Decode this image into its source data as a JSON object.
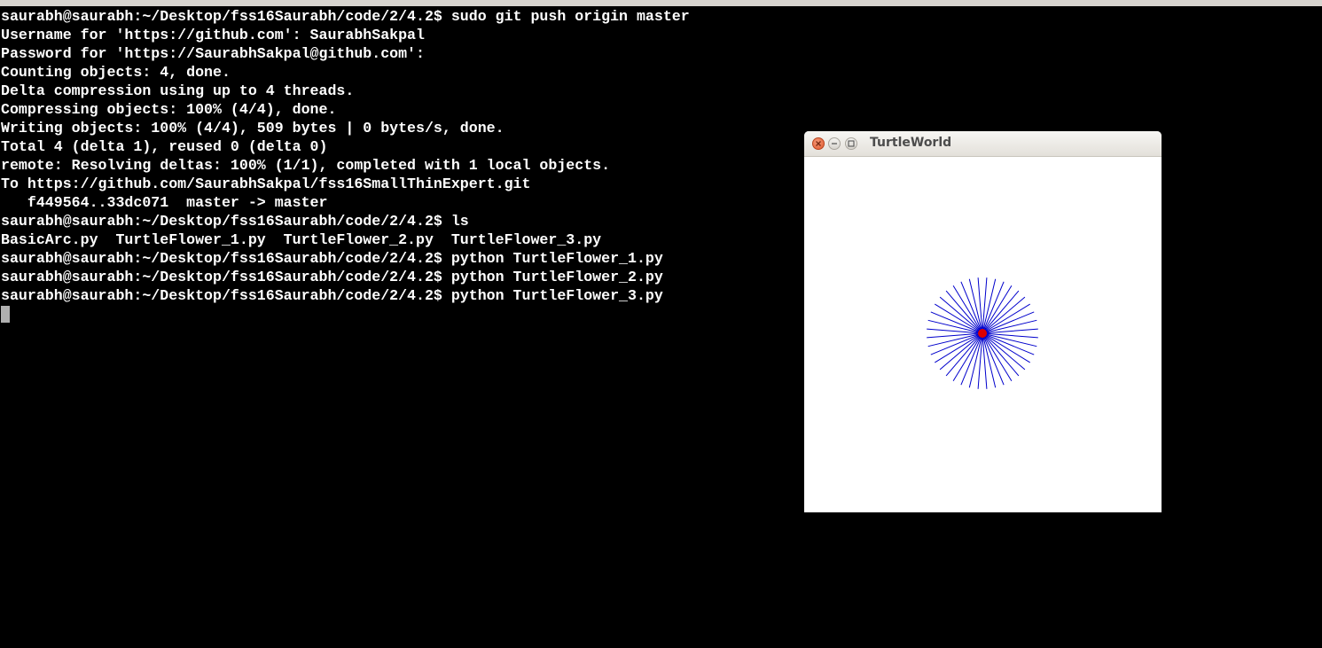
{
  "terminal": {
    "lines": [
      "saurabh@saurabh:~/Desktop/fss16Saurabh/code/2/4.2$ sudo git push origin master",
      "Username for 'https://github.com': SaurabhSakpal",
      "Password for 'https://SaurabhSakpal@github.com':",
      "Counting objects: 4, done.",
      "Delta compression using up to 4 threads.",
      "Compressing objects: 100% (4/4), done.",
      "Writing objects: 100% (4/4), 509 bytes | 0 bytes/s, done.",
      "Total 4 (delta 1), reused 0 (delta 0)",
      "remote: Resolving deltas: 100% (1/1), completed with 1 local objects.",
      "To https://github.com/SaurabhSakpal/fss16SmallThinExpert.git",
      "   f449564..33dc071  master -> master",
      "saurabh@saurabh:~/Desktop/fss16Saurabh/code/2/4.2$ ls",
      "BasicArc.py  TurtleFlower_1.py  TurtleFlower_2.py  TurtleFlower_3.py",
      "saurabh@saurabh:~/Desktop/fss16Saurabh/code/2/4.2$ python TurtleFlower_1.py",
      "saurabh@saurabh:~/Desktop/fss16Saurabh/code/2/4.2$ python TurtleFlower_2.py",
      "saurabh@saurabh:~/Desktop/fss16Saurabh/code/2/4.2$ python TurtleFlower_3.py"
    ]
  },
  "turtle_window": {
    "title": "TurtleWorld",
    "buttons": {
      "close": "close-icon",
      "minimize": "minimize-icon",
      "maximize": "maximize-icon"
    },
    "drawing": {
      "petal_count": 20,
      "stroke_color": "#0000cc",
      "turtle_color": "#dd0000"
    }
  },
  "colors": {
    "terminal_bg": "#000000",
    "terminal_fg": "#ffffff",
    "titlebar": "#e9e6e1"
  }
}
